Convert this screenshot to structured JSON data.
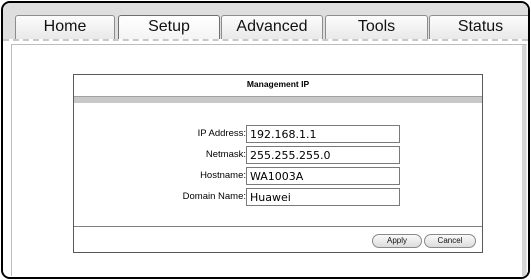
{
  "nav": {
    "tabs": [
      {
        "label": "Home"
      },
      {
        "label": "Setup"
      },
      {
        "label": "Advanced"
      },
      {
        "label": "Tools"
      },
      {
        "label": "Status"
      }
    ],
    "active": "Setup"
  },
  "section": {
    "title": "Management IP"
  },
  "form": {
    "ip_address": {
      "label": "IP Address:",
      "value": "192.168.1.1"
    },
    "netmask": {
      "label": "Netmask:",
      "value": "255.255.255.0"
    },
    "hostname": {
      "label": "Hostname:",
      "value": "WA1003A"
    },
    "domain_name": {
      "label": "Domain Name:",
      "value": "Huawei"
    }
  },
  "buttons": {
    "apply": "Apply",
    "cancel": "Cancel"
  }
}
